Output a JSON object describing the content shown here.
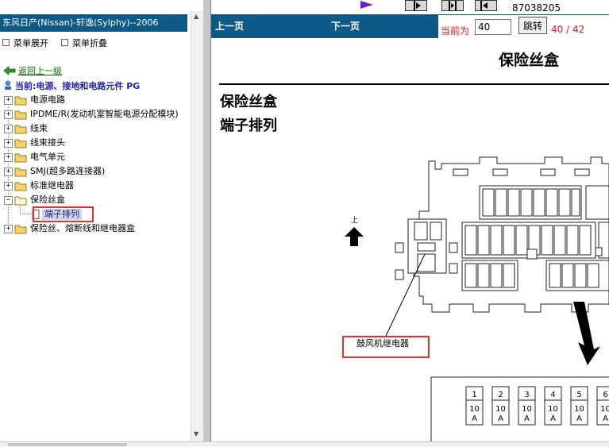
{
  "left_pane": {
    "title": "东风日产(Nissan)-轩逸(Sylphy)--2006",
    "expand_label": "菜单展开",
    "collapse_label": "菜单折叠",
    "back_label": "返回上一级",
    "current_label": "当前:电源、接地和电路元件 PG",
    "tree_items": [
      {
        "label": "电源电路"
      },
      {
        "label": "IPDME/R(发动机室智能电源分配模块)"
      },
      {
        "label": "线束"
      },
      {
        "label": "线束接头"
      },
      {
        "label": "电气单元"
      },
      {
        "label": "SMJ(超多路连接器)"
      },
      {
        "label": "标准继电器"
      },
      {
        "label": "保险丝盒"
      },
      {
        "label": "保险丝、熔断线和继电器盒"
      }
    ],
    "selected_leaf": "端子排列"
  },
  "toolbar": {
    "code": "87038205"
  },
  "nav": {
    "prev_label": "上一页",
    "next_label": "下一页",
    "current_page_label": "当前为",
    "page_value": "40",
    "jump_label": "跳转",
    "page_count": "40 / 42"
  },
  "document": {
    "header": "保险丝盒",
    "title1": "保险丝盒",
    "title2": "端子排列",
    "up_label": "上",
    "callout_label": "鼓风机继电器",
    "fuses": [
      {
        "num": "1",
        "amp": "10",
        "unit": "A"
      },
      {
        "num": "2",
        "amp": "10",
        "unit": "A"
      },
      {
        "num": "3",
        "amp": "10",
        "unit": "A"
      },
      {
        "num": "4",
        "amp": "10",
        "unit": "A"
      },
      {
        "num": "5",
        "amp": "10",
        "unit": "A"
      },
      {
        "num": "6",
        "amp": "10",
        "unit": "A"
      }
    ]
  },
  "colors": {
    "header_blue": "#0d5a86",
    "highlight_red": "#e53030",
    "link_green": "#007000",
    "page_red": "#e01818"
  }
}
